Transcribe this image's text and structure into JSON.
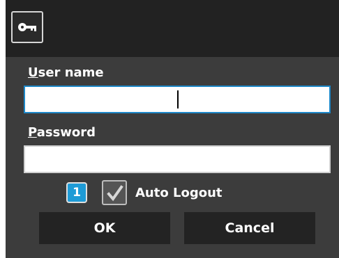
{
  "titlebar": {
    "icon": "key-icon"
  },
  "form": {
    "username_label_accel": "U",
    "username_label_rest": "ser name",
    "username_value": "",
    "password_label_accel": "P",
    "password_label_rest": "assword",
    "password_value": ""
  },
  "options": {
    "badge_number": "1",
    "auto_logout_label": "Auto Logout",
    "auto_logout_checked": true
  },
  "buttons": {
    "ok_label": "OK",
    "cancel_label": "Cancel"
  },
  "colors": {
    "background": "#3c3c3c",
    "titlebar": "#222222",
    "focus_border": "#1e88c8",
    "badge": "#1e9bd6",
    "button": "#232323"
  }
}
